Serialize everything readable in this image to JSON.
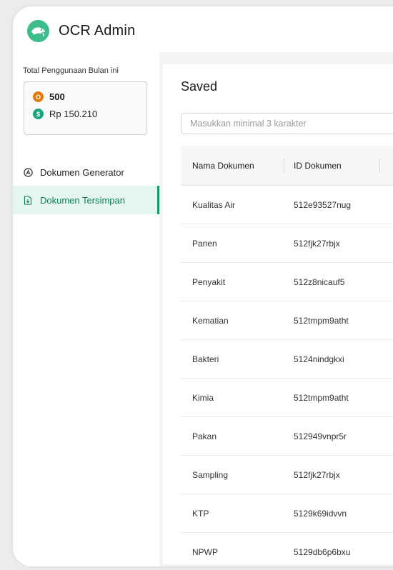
{
  "app": {
    "title": "OCR Admin",
    "accent": "#129c72"
  },
  "usage": {
    "label": "Total Penggunaan Bulan ini",
    "token_icon": "coin-icon",
    "token_badge": "O",
    "tokens": "500",
    "money_icon": "dollar-icon",
    "money_badge": "$",
    "amount": "Rp 150.210"
  },
  "nav": {
    "generator": {
      "label": "Dokumen Generator",
      "icon": "a-circle-icon"
    },
    "saved": {
      "label": "Dokumen Tersimpan",
      "icon": "file-download-icon",
      "active": true
    }
  },
  "page": {
    "title": "Saved",
    "search_placeholder": "Masukkan minimal 3 karakter"
  },
  "table": {
    "columns": [
      "Nama Dokumen",
      "ID Dokumen"
    ],
    "rows": [
      [
        "Kualitas Air",
        "512e93527nug"
      ],
      [
        "Panen",
        "512fjk27rbjx"
      ],
      [
        "Penyakit",
        "512z8nicauf5"
      ],
      [
        "Kematian",
        "512tmpm9atht"
      ],
      [
        "Bakteri",
        "5124nindgkxi"
      ],
      [
        "Kimia",
        "512tmpm9atht"
      ],
      [
        "Pakan",
        "512949vnpr5r"
      ],
      [
        "Sampling",
        "512fjk27rbjx"
      ],
      [
        "KTP",
        "5129k69idvvn"
      ],
      [
        "NPWP",
        "5129db6p6bxu"
      ]
    ]
  }
}
